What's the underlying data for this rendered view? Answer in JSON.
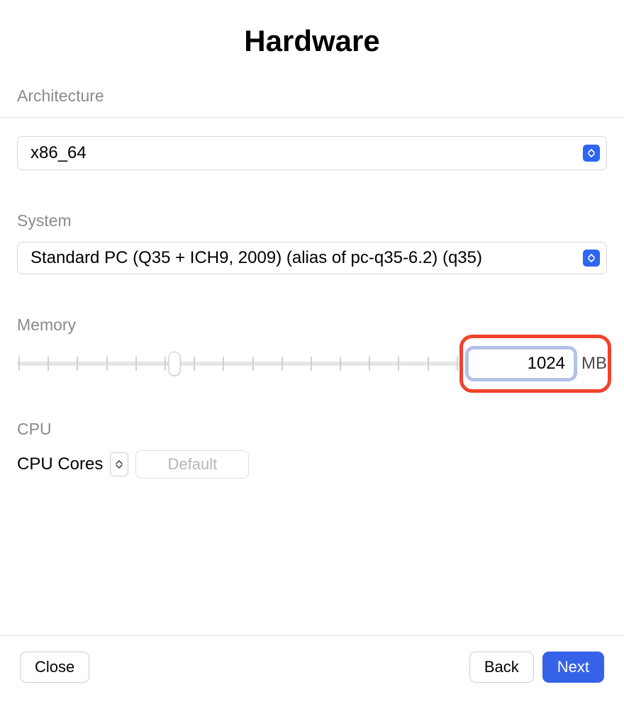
{
  "title": "Hardware",
  "architecture": {
    "label": "Architecture",
    "value": "x86_64"
  },
  "system": {
    "label": "System",
    "value": "Standard PC (Q35 + ICH9, 2009) (alias of pc-q35-6.2) (q35)"
  },
  "memory": {
    "label": "Memory",
    "value": "1024",
    "unit": "MB"
  },
  "cpu": {
    "label": "CPU",
    "cores_label": "CPU Cores",
    "default_label": "Default"
  },
  "footer": {
    "close": "Close",
    "back": "Back",
    "next": "Next"
  }
}
